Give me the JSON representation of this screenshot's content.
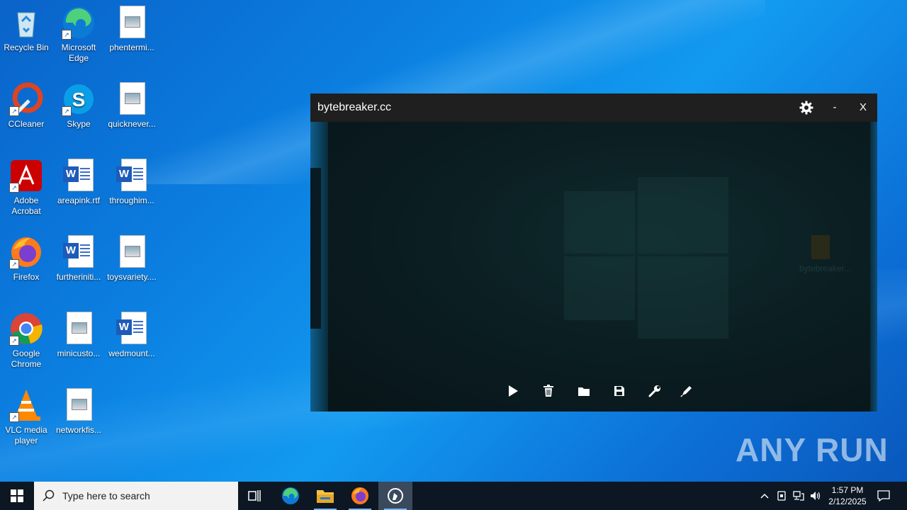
{
  "desktop": {
    "icons": [
      {
        "label": "Recycle Bin"
      },
      {
        "label": "Microsoft Edge"
      },
      {
        "label": "phentermi..."
      },
      {
        "label": "CCleaner"
      },
      {
        "label": "Skype"
      },
      {
        "label": "quicknever..."
      },
      {
        "label": "Adobe Acrobat"
      },
      {
        "label": "areapink.rtf"
      },
      {
        "label": "throughim..."
      },
      {
        "label": "Firefox"
      },
      {
        "label": "furtheriniti..."
      },
      {
        "label": "toysvariety...."
      },
      {
        "label": "Google Chrome"
      },
      {
        "label": "minicusto..."
      },
      {
        "label": "wedmount..."
      },
      {
        "label": "VLC media player"
      },
      {
        "label": "networkfis..."
      }
    ]
  },
  "window": {
    "title": "bytebreaker.cc",
    "minimize_label": "-",
    "close_label": "X",
    "ghost_file_label": "bytebreaker..."
  },
  "watermark": {
    "text": "ANY RUN"
  },
  "taskbar": {
    "search_placeholder": "Type here to search",
    "time": "1:57 PM",
    "date": "2/12/2025"
  }
}
